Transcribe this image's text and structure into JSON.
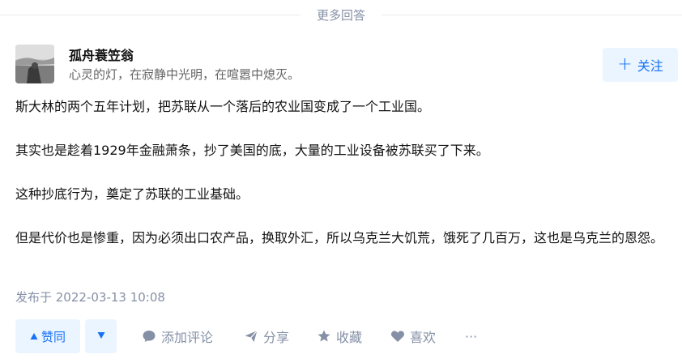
{
  "divider": {
    "label": "更多回答"
  },
  "author": {
    "name": "孤舟蓑笠翁",
    "bio": "心灵的灯，在寂静中光明，在喧嚣中熄灭。"
  },
  "follow": {
    "label": "关注"
  },
  "answer": {
    "paragraphs": [
      "斯大林的两个五年计划，把苏联从一个落后的农业国变成了一个工业国。",
      "其实也是趁着1929年金融萧条，抄了美国的底，大量的工业设备被苏联买了下来。",
      "这种抄底行为，奠定了苏联的工业基础。",
      "但是代价也是惨重，因为必须出口农产品，换取外汇，所以乌克兰大饥荒，饿死了几百万，这也是乌克兰的恩怨。"
    ],
    "published": "发布于 2022-03-13 10:08"
  },
  "actions": {
    "upvote": "赞同",
    "comment": "添加评论",
    "share": "分享",
    "favorite": "收藏",
    "like": "喜欢",
    "more": "···"
  },
  "colors": {
    "accent": "#1772f6",
    "accent_bg": "#ebf5ff",
    "muted": "#8590a6"
  }
}
